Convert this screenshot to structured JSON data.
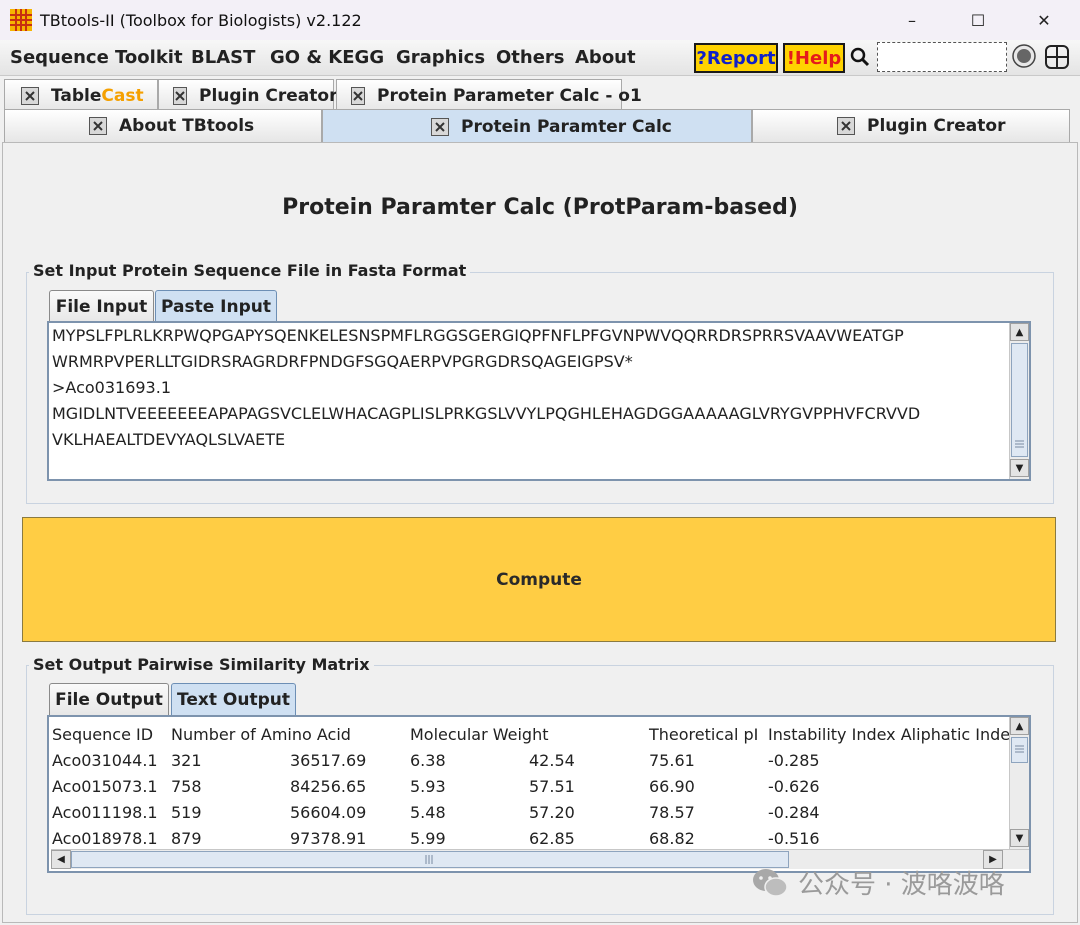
{
  "window": {
    "title": "TBtools-II (Toolbox for Biologists) v2.122",
    "minimize": "–",
    "maximize": "☐",
    "close": "✕"
  },
  "menu": {
    "items": [
      "Sequence Toolkit",
      "BLAST",
      "GO & KEGG",
      "Graphics",
      "Others",
      "About"
    ],
    "report": "?Report",
    "help": "!Help",
    "search_value": ""
  },
  "tabs": {
    "row1": [
      {
        "label_a": "Table ",
        "label_b": "Cast"
      },
      {
        "label": "Plugin Creator"
      },
      {
        "label": "Protein Parameter Calc - o1"
      }
    ],
    "row2": [
      {
        "label": "About TBtools"
      },
      {
        "label": "Protein Paramter Calc"
      },
      {
        "label": "Plugin Creator"
      }
    ]
  },
  "page": {
    "title": "Protein Paramter Calc (ProtParam-based)"
  },
  "input_group": {
    "label": "Set Input Protein Sequence File in Fasta Format",
    "tabs": [
      "File Input",
      "Paste Input"
    ],
    "lines": [
      "MYPSLFPLRLKRPWQPGAPYSQENKELESNSPMFLRGGSGERGIQPFNFLPFGVNPWVQQRRDRSPRRSVAAVWEATGP",
      "WRMRPVPERLLTGIDRSRAGRDRFPNDGFSGQAERPVPGRGDRSQAGEIGPSV*",
      ">Aco031693.1",
      "MGIDLNTVEEEEEEEAPAPAGSVCLELWHACAGPLISLPRKGSLVVYLPQGHLEHAGDGGAAAAAGLVRYGVPPHVFCRVVD",
      "VKLHAEALTDEVYAQLSLVAETE"
    ]
  },
  "compute": {
    "label": "Compute"
  },
  "output_group": {
    "label": "Set Output Pairwise Similarity Matrix",
    "tabs": [
      "File Output",
      "Text Output"
    ],
    "header": [
      "Sequence ID",
      "Number of Amino Acid",
      "Molecular Weight",
      "Theoretical pI",
      "Instability Index Aliphatic Index"
    ],
    "rows": [
      [
        "Aco031044.1",
        "321",
        "36517.69",
        "6.38",
        "42.54",
        "75.61",
        "-0.285"
      ],
      [
        "Aco015073.1",
        "758",
        "84256.65",
        "5.93",
        "57.51",
        "66.90",
        "-0.626"
      ],
      [
        "Aco011198.1",
        "519",
        "56604.09",
        "5.48",
        "57.20",
        "78.57",
        "-0.284"
      ],
      [
        "Aco018978.1",
        "879",
        "97378.91",
        "5.99",
        "62.85",
        "68.82",
        "-0.516"
      ]
    ]
  },
  "watermark": {
    "text": "公众号 · 波咯波咯"
  },
  "colors": {
    "accent_yellow": "#ffcd44",
    "active_tab": "#cfe0f2",
    "report_text": "#1020c8",
    "help_text": "#e51b1b"
  }
}
